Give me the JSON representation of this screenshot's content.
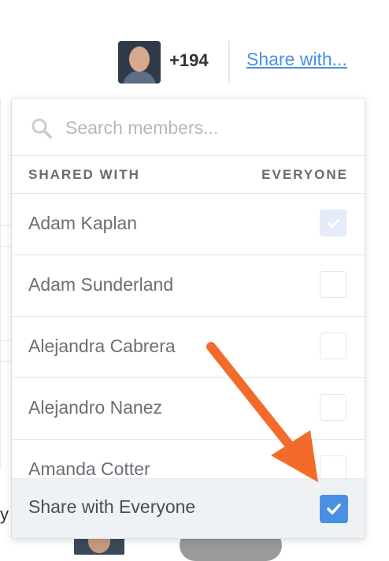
{
  "header": {
    "member_count_label": "+194",
    "share_link_label": "Share with..."
  },
  "popup": {
    "search_placeholder": "Search members...",
    "columns": {
      "shared_with": "SHARED WITH",
      "everyone": "EVERYONE"
    },
    "members": [
      {
        "name": "Adam Kaplan",
        "checked": true
      },
      {
        "name": "Adam Sunderland",
        "checked": false
      },
      {
        "name": "Alejandra Cabrera",
        "checked": false
      },
      {
        "name": "Alejandro Nanez",
        "checked": false
      },
      {
        "name": "Amanda Cotter",
        "checked": false
      }
    ],
    "share_everyone": {
      "label": "Share with Everyone",
      "checked": true
    }
  },
  "background": {
    "partial_text": "y"
  },
  "colors": {
    "accent": "#4a90e2",
    "annotation_arrow": "#f26b2a"
  }
}
